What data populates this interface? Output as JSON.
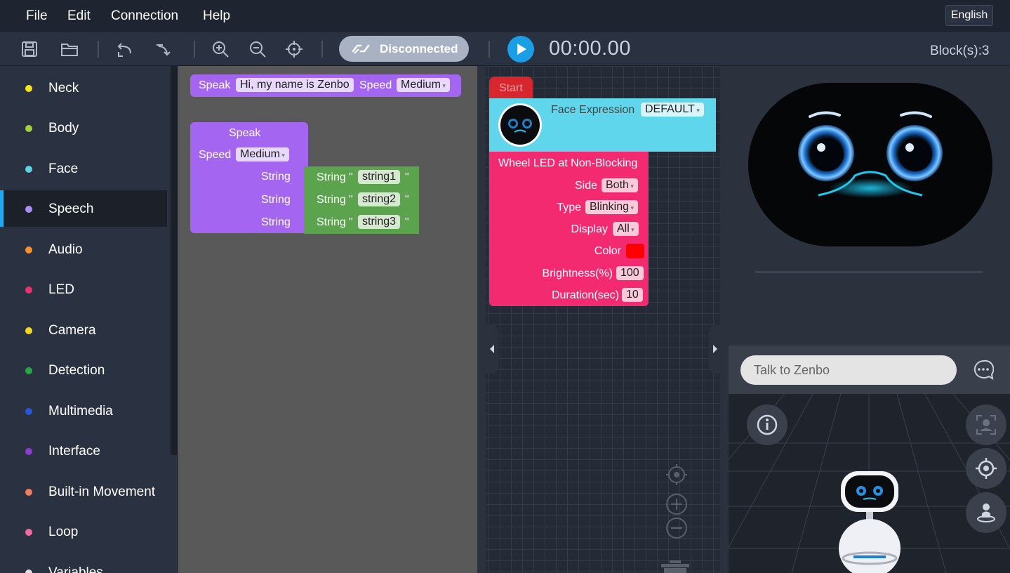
{
  "menu": {
    "file": "File",
    "edit": "Edit",
    "connection": "Connection",
    "help": "Help",
    "language": "English"
  },
  "toolbar": {
    "connection_status": "Disconnected",
    "timer": "00:00.00",
    "block_count": "Block(s):3"
  },
  "categories": [
    {
      "label": "Neck",
      "color": "#f5e51b"
    },
    {
      "label": "Body",
      "color": "#9ed33b"
    },
    {
      "label": "Face",
      "color": "#5fd3e6"
    },
    {
      "label": "Speech",
      "color": "#b28af5"
    },
    {
      "label": "Audio",
      "color": "#f7922a"
    },
    {
      "label": "LED",
      "color": "#f0306c"
    },
    {
      "label": "Camera",
      "color": "#f5d81b"
    },
    {
      "label": "Detection",
      "color": "#28a745"
    },
    {
      "label": "Multimedia",
      "color": "#2a55d8"
    },
    {
      "label": "Interface",
      "color": "#8a3ed1"
    },
    {
      "label": "Built-in Movement",
      "color": "#f47b5c"
    },
    {
      "label": "Loop",
      "color": "#f46b9c"
    },
    {
      "label": "Variables",
      "color": "#e0e0e0"
    }
  ],
  "active_category": "Speech",
  "flyout": {
    "speak1": {
      "label": "Speak",
      "text": "Hi, my name is Zenbo",
      "speed_label": "Speed",
      "speed": "Medium"
    },
    "speak2": {
      "label": "Speak",
      "speed_label": "Speed",
      "speed": "Medium",
      "string_label": "String",
      "strings": [
        {
          "label": "String",
          "value": "string1"
        },
        {
          "label": "String",
          "value": "string2"
        },
        {
          "label": "String",
          "value": "string3"
        }
      ],
      "quote": "\""
    }
  },
  "workspace": {
    "start": "Start",
    "face": {
      "label": "Face Expression",
      "value": "DEFAULT"
    },
    "wheel_led": {
      "title": "Wheel LED at Non-Blocking",
      "side_label": "Side",
      "side": "Both",
      "type_label": "Type",
      "type": "Blinking",
      "display_label": "Display",
      "display": "All",
      "color_label": "Color",
      "color": "#ff0000",
      "brightness_label": "Brightness(%)",
      "brightness": "100",
      "duration_label": "Duration(sec)",
      "duration": "10"
    }
  },
  "chat": {
    "placeholder": "Talk to Zenbo"
  },
  "colors": {
    "speech": "#a466f0",
    "string": "#5ca34e",
    "face": "#5fd6ec",
    "led": "#f42a70",
    "start": "#d8262e",
    "accent": "#1a9fe6"
  }
}
